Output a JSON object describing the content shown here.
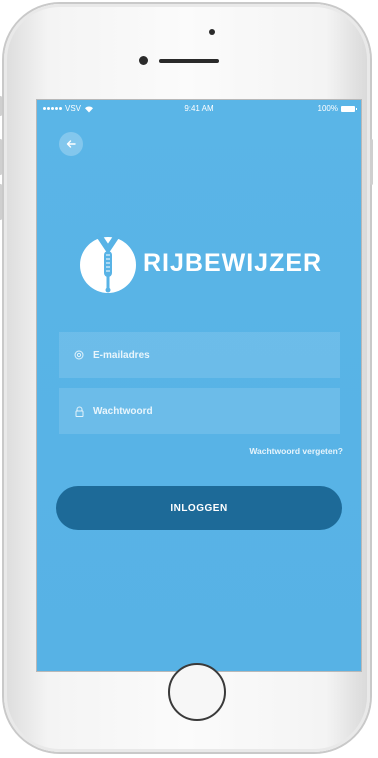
{
  "status_bar": {
    "carrier": "VSV",
    "time": "9:41 AM",
    "battery": "100%"
  },
  "icons": {
    "back": "arrow-left-icon",
    "email": "at-icon",
    "password": "lock-icon",
    "logo": "rijbewijzer-logo-icon"
  },
  "logo": {
    "text": "RIJBEWIJZER"
  },
  "form": {
    "email_placeholder": "E-mailadres",
    "email_value": "",
    "password_placeholder": "Wachtwoord",
    "password_value": "",
    "forgot_label": "Wachtwoord vergeten?",
    "login_label": "INLOGGEN"
  },
  "colors": {
    "screen_background": "#58b3e6",
    "login_button": "#1d6a98",
    "text": "#ffffff"
  }
}
